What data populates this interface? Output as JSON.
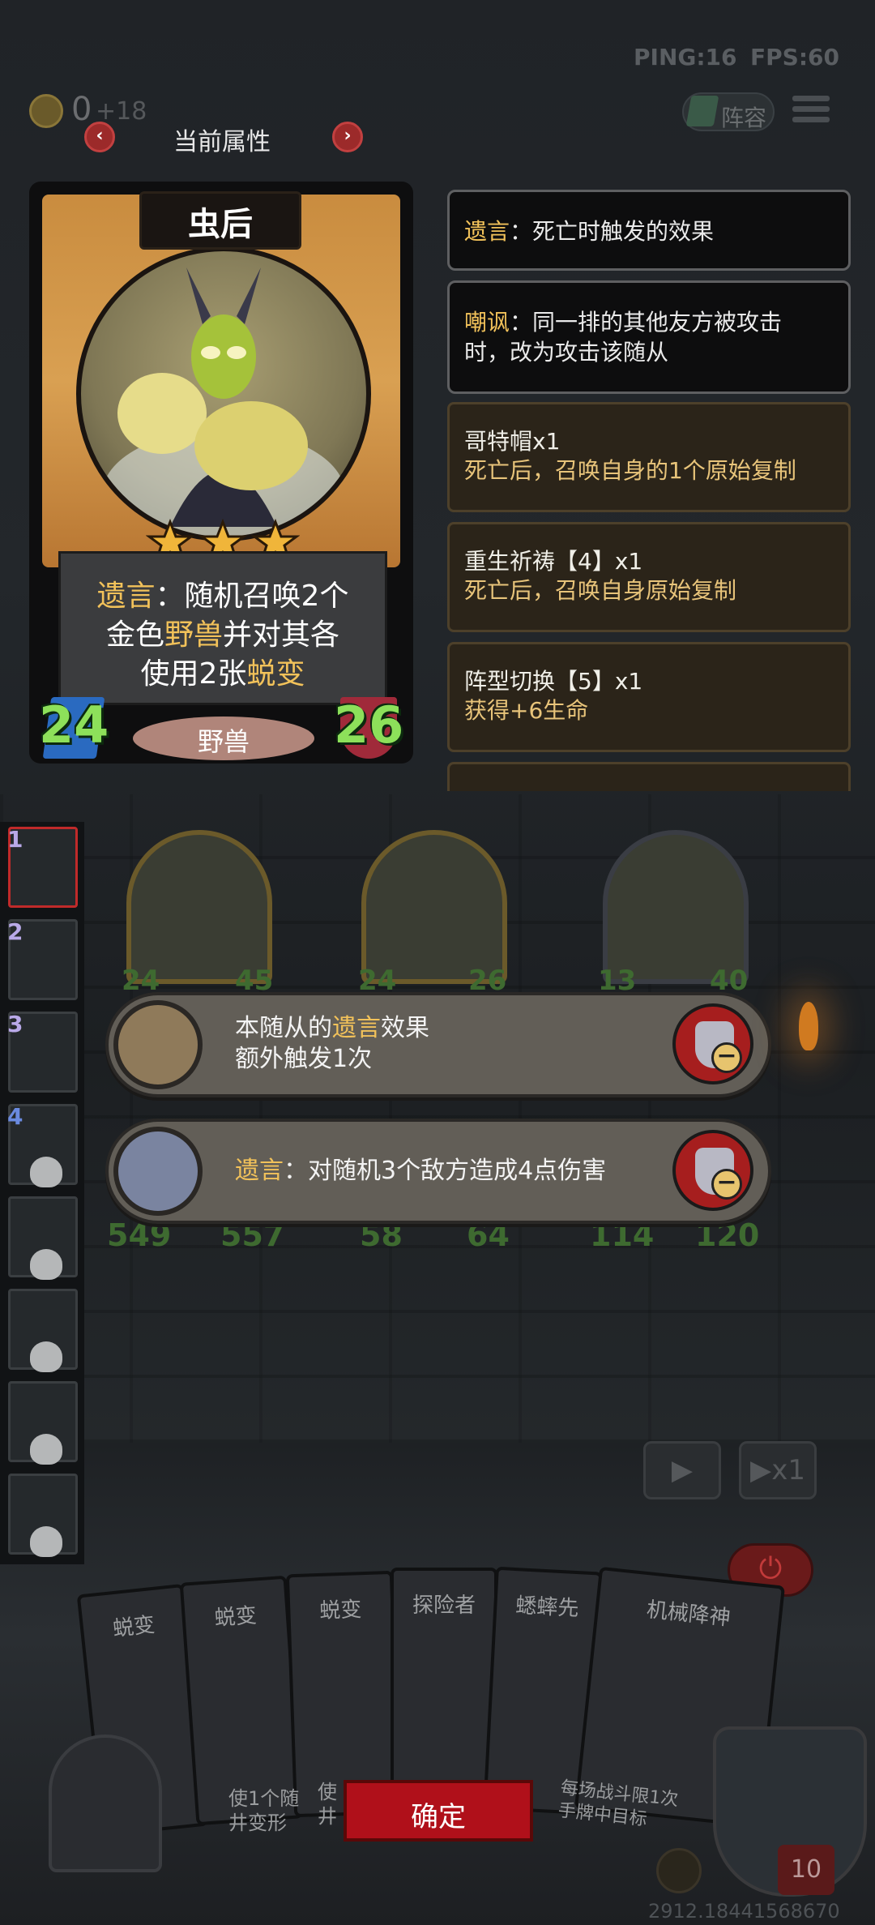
{
  "hud": {
    "ping": "PING:16",
    "fps": "FPS:60",
    "gold": "0",
    "gold_income": "+18",
    "lineup_label": "阵容"
  },
  "panel": {
    "title": "当前属性",
    "prev": "‹",
    "next": "›"
  },
  "card": {
    "name": "虫后",
    "stars": 3,
    "desc": {
      "l1a": "遗言",
      "l1b": "：随机召唤2个",
      "l2a": "金色",
      "l2b": "野兽",
      "l2c": "并对其各",
      "l3a": "使用2张",
      "l3b": "蜕变"
    },
    "attack": "24",
    "health": "26",
    "tribe": "野兽"
  },
  "keywords": [
    {
      "key": "遗言",
      "line1": "：死亡时触发的效果",
      "line2": ""
    },
    {
      "key": "嘲讽",
      "line1": "：同一排的其他友方被攻击",
      "line2": "时，改为攻击该随从"
    }
  ],
  "effects": [
    {
      "title": "哥特帽x1",
      "desc": "死亡后，召唤自身的1个原始复制"
    },
    {
      "title": "重生祈祷【4】x1",
      "desc": "死亡后，召唤自身原始复制"
    },
    {
      "title": "阵型切换【5】x1",
      "desc": "获得+6生命"
    }
  ],
  "sidebar": {
    "slots": [
      "1",
      "2",
      "3",
      "4",
      "",
      "",
      "",
      ""
    ]
  },
  "board": {
    "minions": [
      {
        "atk": "24",
        "hp": "45"
      },
      {
        "atk": "24",
        "hp": "26"
      },
      {
        "atk": "13",
        "hp": "40"
      }
    ],
    "row2": [
      {
        "atk": "549",
        "hp": "557"
      },
      {
        "atk": "58",
        "hp": "64"
      },
      {
        "atk": "114",
        "hp": "120"
      }
    ]
  },
  "buffs": [
    {
      "line1a": "本随从的",
      "line1b": "遗言",
      "line1c": "效果",
      "line2": "额外触发1次"
    },
    {
      "a": "遗言",
      "b": "：对随机3个敌方造成4点伤害"
    }
  ],
  "controls": {
    "speed": "▶x1",
    "play": "▶",
    "power": "⏻"
  },
  "hand": [
    "蜕变",
    "蜕变",
    "蜕变",
    "探险者",
    "蟋蟀先",
    "机械降神"
  ],
  "hand_snippets": {
    "c1": "使1个随",
    "c1b": "井变形",
    "c2": "使",
    "c2b": "井",
    "c6": "每场战斗限1次",
    "c6b": "手牌中目标"
  },
  "confirm_label": "确定",
  "hero": {
    "hp": "10"
  },
  "footer_id": "2912.18441568670",
  "colors": {
    "accent_gold": "#f2c25a",
    "stat_green": "#8de05a",
    "confirm_red": "#b0101a"
  }
}
